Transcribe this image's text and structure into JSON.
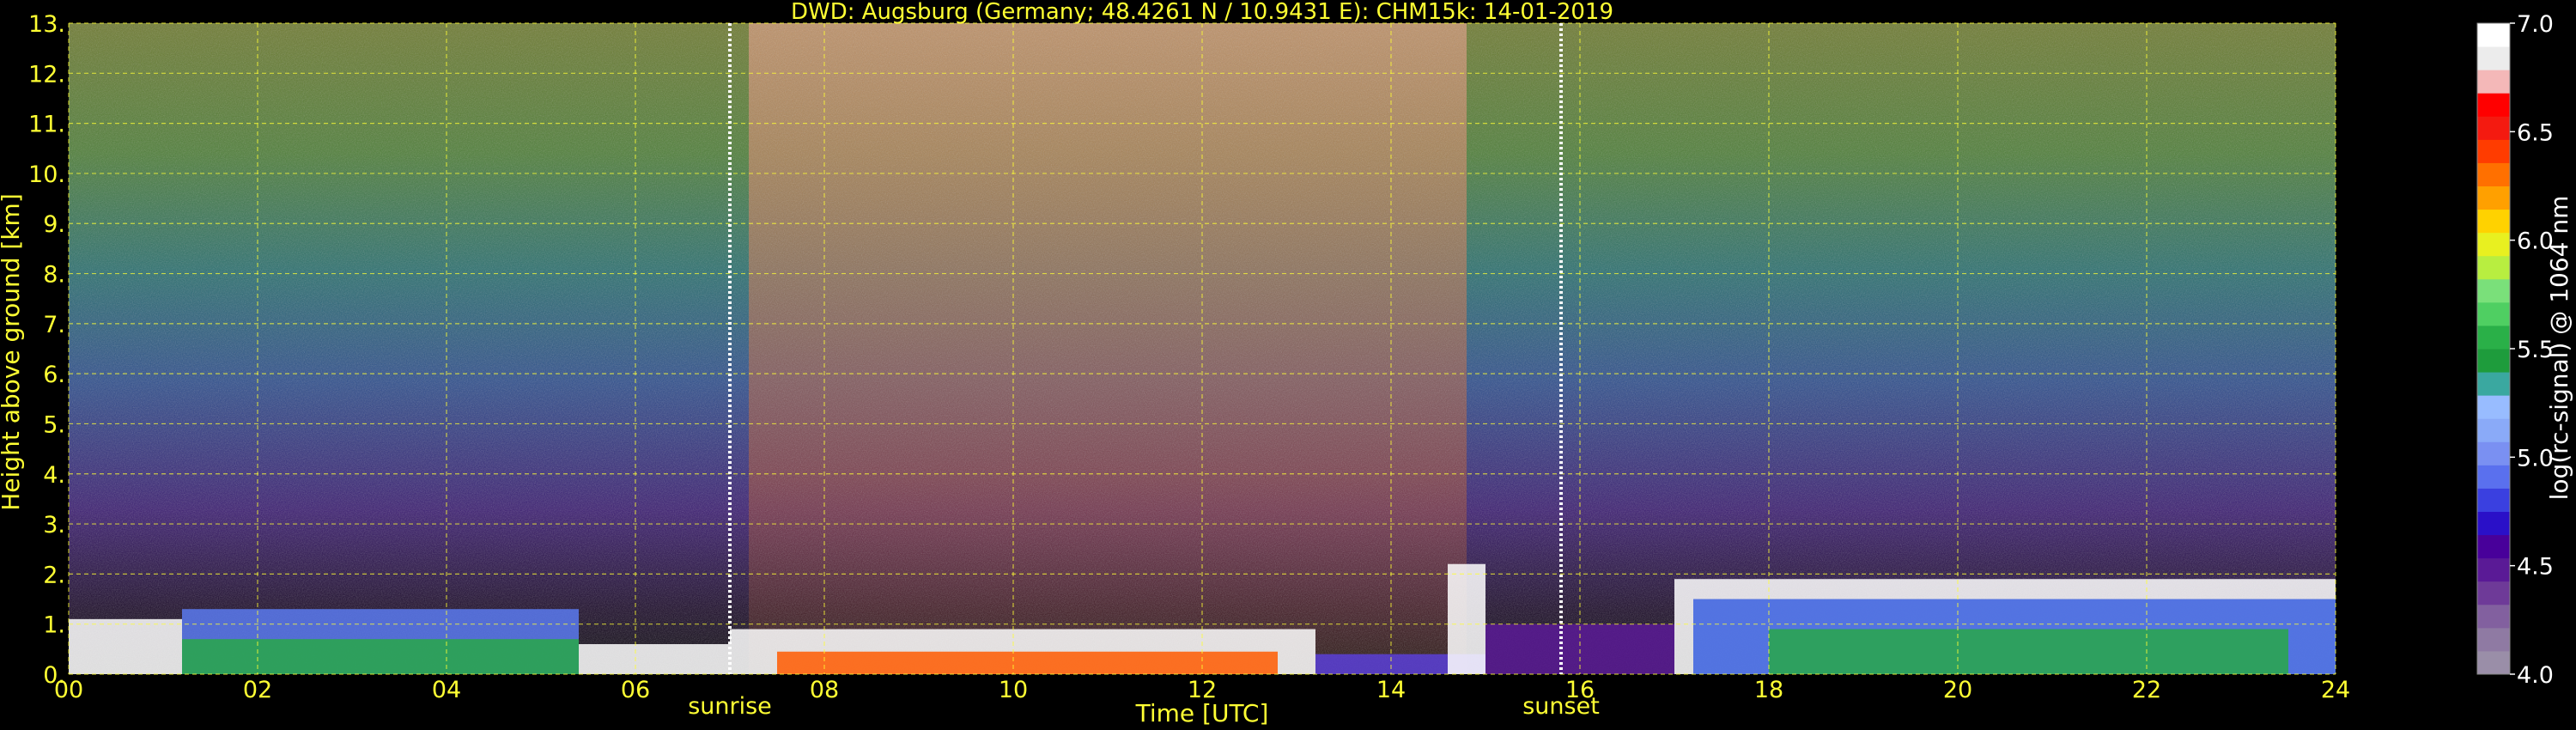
{
  "chart_data": {
    "type": "heatmap",
    "title": "DWD: Augsburg (Germany; 48.4261 N / 10.9431 E):    CHM15k: 14-01-2019",
    "xlabel": "Time [UTC]",
    "ylabel": "Height above ground [km]",
    "xlim": [
      0,
      24
    ],
    "ylim": [
      0,
      13
    ],
    "x_ticks": [
      "00",
      "02",
      "04",
      "06",
      "08",
      "10",
      "12",
      "14",
      "16",
      "18",
      "20",
      "22",
      "24"
    ],
    "y_ticks": [
      "0.",
      "1.",
      "2.",
      "3.",
      "4.",
      "5.",
      "6.",
      "7.",
      "8.",
      "9.",
      "10.",
      "11.",
      "12.",
      "13."
    ],
    "grid": true,
    "events": [
      {
        "label": "sunrise",
        "time": 7.0
      },
      {
        "label": "sunset",
        "time": 15.8
      }
    ],
    "colorbar": {
      "label": "log(rc-signal) @ 1064 nm",
      "range": [
        4.0,
        7.0
      ],
      "ticks": [
        "4.0",
        "4.5",
        "5.0",
        "5.5",
        "6.0",
        "6.5",
        "7.0"
      ],
      "colors": [
        "#9a8ea8",
        "#8f7aa3",
        "#82609f",
        "#6e3a98",
        "#5a1a96",
        "#48009a",
        "#2a10c8",
        "#3a40e0",
        "#5a70ee",
        "#7a90f2",
        "#8aaaf8",
        "#98bcff",
        "#3aa8a0",
        "#1e9c3c",
        "#2ab048",
        "#4fcf62",
        "#7ae07a",
        "#b8ee40",
        "#e8f020",
        "#ffd200",
        "#ffa000",
        "#ff7000",
        "#ff3c00",
        "#f41a10",
        "#ff0000",
        "#f4b8b8",
        "#ececec",
        "#ffffff"
      ]
    }
  },
  "colors": {
    "axis_text": "#ffff33",
    "colorbar_text": "#ffffff",
    "background": "#000000"
  }
}
